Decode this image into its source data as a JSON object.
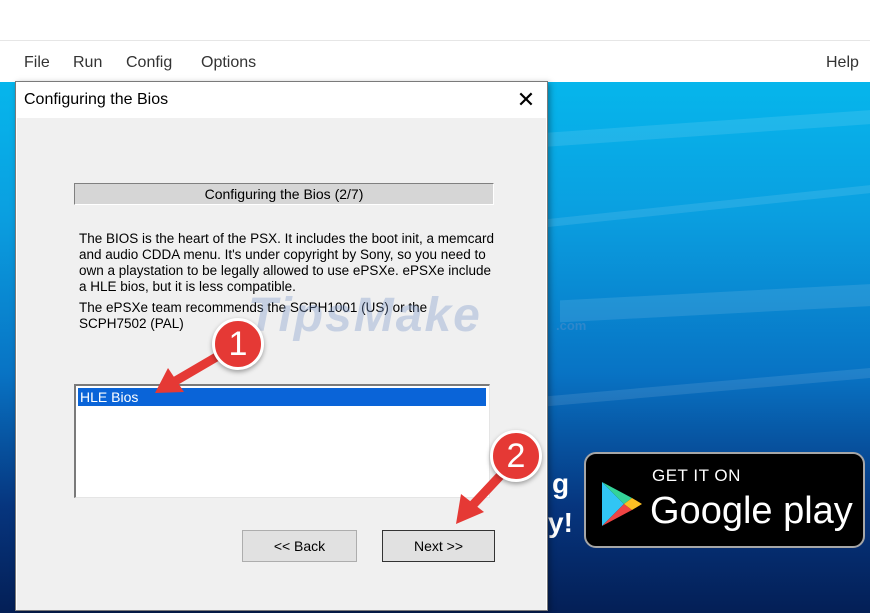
{
  "menubar": {
    "items": [
      "File",
      "Run",
      "Config",
      "Options"
    ],
    "help": "Help"
  },
  "dialog": {
    "title": "Configuring the Bios",
    "close_glyph": "✕",
    "step_header": "Configuring the Bios (2/7)",
    "description": [
      "The BIOS is the heart of the PSX. It includes the boot init, a memcard and audio CDDA menu. It's under copyright by Sony, so you need to own a playstation to be legally allowed to use ePSXe. ePSXe include a HLE bios, but it is less compatible.",
      "The ePSXe team recommends the SCPH1001 (US) or the SCPH7502 (PAL)"
    ],
    "bios_list": {
      "items": [
        "HLE Bios"
      ],
      "selected_index": 0
    },
    "back_label": "<< Back",
    "next_label": "Next >>"
  },
  "promo": {
    "partial_text_1": "g",
    "partial_text_2": "y!",
    "badge_get": "GET IT ON",
    "badge_store": "Google play"
  },
  "watermark": {
    "text": "TipsMake",
    "suffix": ".com"
  },
  "callouts": [
    "1",
    "2"
  ],
  "icons": {
    "close": "close-icon",
    "play_logo": "google-play-icon",
    "arrow": "red-arrow-icon"
  },
  "colors": {
    "accent_selection": "#0a64d8",
    "callout_red": "#e53935",
    "background_blue": "#0873c4"
  }
}
